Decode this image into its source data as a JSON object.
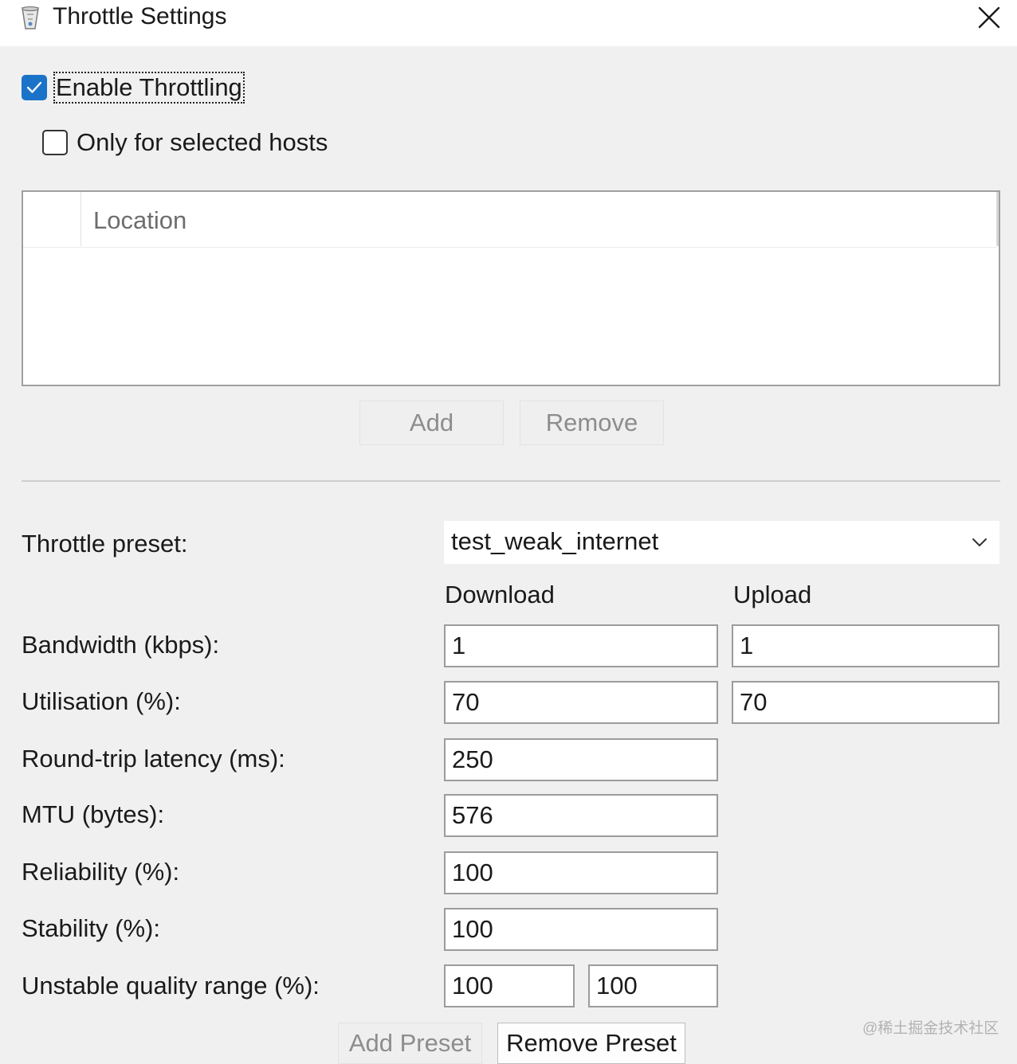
{
  "window": {
    "title": "Throttle Settings",
    "icon": "app-icon",
    "close_icon": "close-icon"
  },
  "options": {
    "enable_throttling": {
      "label": "Enable Throttling",
      "checked": true
    },
    "only_selected_hosts": {
      "label": "Only for selected hosts",
      "checked": false
    }
  },
  "hosts_table": {
    "column_header": "Location",
    "rows": []
  },
  "host_buttons": {
    "add": "Add",
    "remove": "Remove"
  },
  "preset": {
    "label": "Throttle preset:",
    "selected": "test_weak_internet"
  },
  "columns": {
    "download": "Download",
    "upload": "Upload"
  },
  "settings": {
    "bandwidth": {
      "label": "Bandwidth (kbps):",
      "download": "1",
      "upload": "1"
    },
    "utilisation": {
      "label": "Utilisation (%):",
      "download": "70",
      "upload": "70"
    },
    "latency": {
      "label": "Round-trip latency (ms):",
      "value": "250"
    },
    "mtu": {
      "label": "MTU (bytes):",
      "value": "576"
    },
    "reliability": {
      "label": "Reliability (%):",
      "value": "100"
    },
    "stability": {
      "label": "Stability (%):",
      "value": "100"
    },
    "unstable_range": {
      "label": "Unstable quality range (%):",
      "min": "100",
      "max": "100"
    }
  },
  "preset_buttons": {
    "add_preset": "Add Preset",
    "remove_preset": "Remove Preset"
  },
  "colors": {
    "accent": "#1a73c8",
    "window_bg": "#f0f0f0",
    "disabled_text": "#8d8d8d"
  },
  "watermark": "@稀土掘金技术社区"
}
